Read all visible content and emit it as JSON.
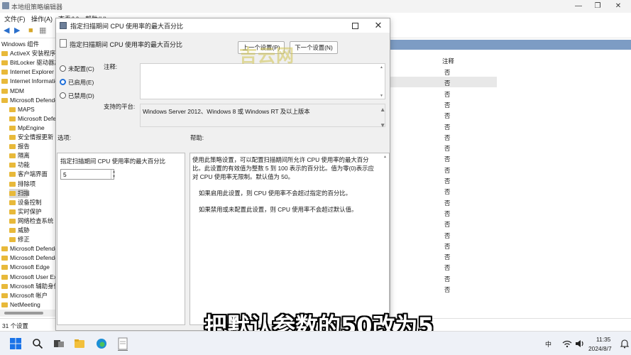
{
  "bg_window": {
    "title": "本地组策略编辑器",
    "menu": [
      "文件(F)",
      "操作(A)",
      "查看(V)",
      "帮助(H)"
    ],
    "tree_items": [
      {
        "label": "Windows 组件",
        "level": 0,
        "folder": false
      },
      {
        "label": "ActiveX 安装程序服务",
        "level": 1,
        "folder": true
      },
      {
        "label": "BitLocker 驱动器加密",
        "level": 1,
        "folder": true
      },
      {
        "label": "Internet Explorer",
        "level": 1,
        "folder": true
      },
      {
        "label": "Internet Information Services",
        "level": 1,
        "folder": true
      },
      {
        "label": "MDM",
        "level": 1,
        "folder": true
      },
      {
        "label": "Microsoft Defender 防病毒",
        "level": 1,
        "folder": true
      },
      {
        "label": "MAPS",
        "level": 2,
        "folder": true
      },
      {
        "label": "Microsoft Defender Exploit Guard",
        "level": 2,
        "folder": true
      },
      {
        "label": "MpEngine",
        "level": 2,
        "folder": true
      },
      {
        "label": "安全情报更新",
        "level": 2,
        "folder": true
      },
      {
        "label": "报告",
        "level": 2,
        "folder": true
      },
      {
        "label": "隔离",
        "level": 2,
        "folder": true
      },
      {
        "label": "功能",
        "level": 2,
        "folder": true
      },
      {
        "label": "客户端界面",
        "level": 2,
        "folder": true
      },
      {
        "label": "排除项",
        "level": 2,
        "folder": true
      },
      {
        "label": "扫描",
        "level": 2,
        "folder": true,
        "selected": true
      },
      {
        "label": "设备控制",
        "level": 2,
        "folder": true
      },
      {
        "label": "实时保护",
        "level": 2,
        "folder": true
      },
      {
        "label": "网络检查系统",
        "level": 2,
        "folder": true
      },
      {
        "label": "威胁",
        "level": 2,
        "folder": true
      },
      {
        "label": "修正",
        "level": 2,
        "folder": true
      },
      {
        "label": "Microsoft Defender 应用程序防护",
        "level": 1,
        "folder": true
      },
      {
        "label": "Microsoft Defender SmartScreen",
        "level": 1,
        "folder": true
      },
      {
        "label": "Microsoft Edge",
        "level": 1,
        "folder": true
      },
      {
        "label": "Microsoft User Experience Virtualization",
        "level": 1,
        "folder": true
      },
      {
        "label": "Microsoft 辅助身份验证因素",
        "level": 1,
        "folder": true
      },
      {
        "label": "Microsoft 帐户",
        "level": 1,
        "folder": true
      },
      {
        "label": "NetMeeting",
        "level": 1,
        "folder": true
      }
    ],
    "list_column_note": "注释",
    "list_values": [
      "否",
      "否",
      "否",
      "否",
      "否",
      "否",
      "否",
      "否",
      "否",
      "否",
      "否",
      "否",
      "否",
      "否",
      "否",
      "否",
      "否",
      "否",
      "否",
      "否",
      "否"
    ],
    "status": "31 个设置"
  },
  "dialog": {
    "title": "指定扫描期间 CPU 使用率的最大百分比",
    "header_title": "指定扫描期间 CPU 使用率的最大百分比",
    "prev_button": "上一个设置(P)",
    "next_button": "下一个设置(N)",
    "radio_not_configured": "未配置(C)",
    "radio_enabled": "已启用(E)",
    "radio_disabled": "已禁用(D)",
    "comment_label": "注释:",
    "supported_label": "支持的平台:",
    "supported_value": "Windows Server 2012、Windows 8 或 Windows RT 及以上版本",
    "options_label": "选项:",
    "help_label": "帮助:",
    "option_field_label": "指定扫描期间 CPU 使用率的最大百分比",
    "option_field_value": "5",
    "help_p1": "使用此策略设置，可以配置扫描期间所允许 CPU 使用率的最大百分比。此设置的有效值为整数 5 到 100 表示的百分比。值为零(0)表示应对 CPU 使用率无限制。默认值为 50。",
    "help_p2": "如果启用此设置，则 CPU 使用率不会超过指定的百分比。",
    "help_p3": "如果禁用或未配置此设置，则 CPU 使用率不会超过默认值。"
  },
  "watermark": "吉云网",
  "caption": "把默认参数的50改为5",
  "taskbar": {
    "ime": "中",
    "time": "11:35",
    "date": "2024/8/7"
  }
}
